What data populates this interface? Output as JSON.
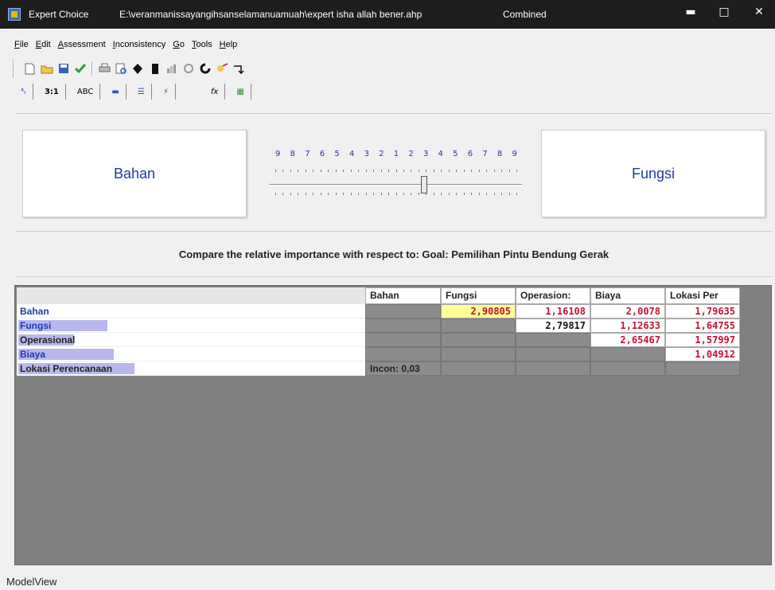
{
  "window": {
    "app_name": "Expert Choice",
    "file_path": "E:\\veranmanissayangihsanselamanuamuah\\expert isha allah bener.ahp",
    "mode": "Combined",
    "minimize_glyph": "▬",
    "maximize_glyph": "□",
    "close_glyph": "✕"
  },
  "menu": [
    "File",
    "Edit",
    "Assessment",
    "Inconsistency",
    "Go",
    "Tools",
    "Help"
  ],
  "toolbar": {
    "icons": [
      "new-file-icon",
      "open-folder-icon",
      "save-icon",
      "check-icon",
      "print-icon",
      "print-preview-icon",
      "tree-icon",
      "black-box-icon",
      "chart-icon",
      "clip-icon",
      "refresh-icon",
      "wizard-icon",
      "arrow-icon"
    ]
  },
  "view_tabs": [
    {
      "name": "tab-tree",
      "label": "⁴ₜ"
    },
    {
      "name": "tab-numerical",
      "label": "3:1"
    },
    {
      "name": "tab-verbal",
      "label": "ABC"
    },
    {
      "name": "tab-graphical-1",
      "label": "▬"
    },
    {
      "name": "tab-graphical-2",
      "label": "☰"
    },
    {
      "name": "tab-questionnaire",
      "label": "⚡"
    },
    {
      "name": "tab-formula",
      "label": "fx"
    },
    {
      "name": "tab-grid",
      "label": "▦"
    }
  ],
  "compare": {
    "left": "Bahan",
    "right": "Fungsi",
    "scale": [
      "9",
      "8",
      "7",
      "6",
      "5",
      "4",
      "3",
      "2",
      "1",
      "2",
      "3",
      "4",
      "5",
      "6",
      "7",
      "8",
      "9"
    ]
  },
  "instruction": "Compare the relative importance with respect to: Goal: Pemilihan Pintu Bendung Gerak",
  "matrix": {
    "columns": [
      "Bahan",
      "Fungsi",
      "Operasion:",
      "Biaya",
      "Lokasi Per"
    ],
    "rows": [
      {
        "label": "Bahan",
        "cells": [
          "",
          "2,90805",
          "1,16108",
          "2,0078",
          "1,79635"
        ]
      },
      {
        "label": "Fungsi",
        "cells": [
          "",
          "",
          "2,79817",
          "1,12633",
          "1,64755"
        ]
      },
      {
        "label": "Operasional",
        "cells": [
          "",
          "",
          "",
          "2,65467",
          "1,57997"
        ]
      },
      {
        "label": "Biaya",
        "cells": [
          "",
          "",
          "",
          "",
          "1,04912"
        ]
      },
      {
        "label": "Lokasi Perencanaan",
        "cells": [
          "Incon: 0,03",
          "",
          "",
          "",
          ""
        ]
      }
    ],
    "colors": {
      "reciprocal": "#c8102e",
      "normal": "#111111",
      "selected_bg": "#ffff99"
    }
  },
  "status": "ModelView"
}
